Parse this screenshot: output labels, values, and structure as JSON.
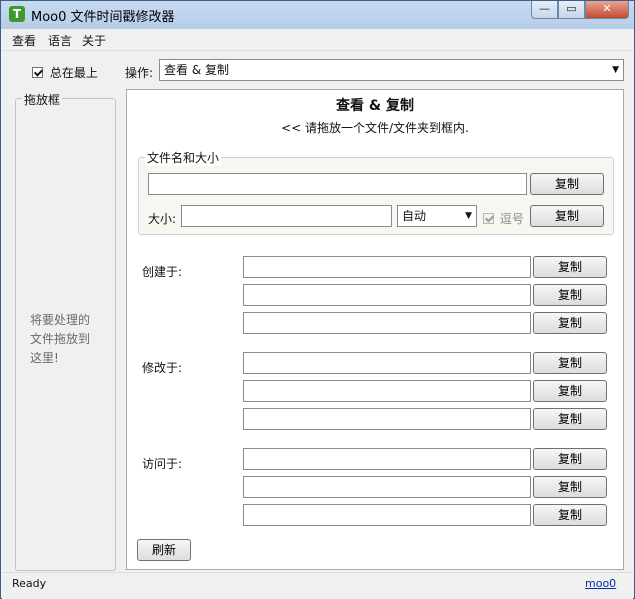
{
  "window": {
    "app_icon_letter": "T",
    "title": "Moo0 文件时间戳修改器",
    "minimize_glyph": "—",
    "maximize_glyph": "▭",
    "close_glyph": "✕"
  },
  "menu": [
    "查看",
    "语言",
    "关于"
  ],
  "topbar": {
    "always_on_top_label": "总在最上",
    "always_on_top_checked": true,
    "operation_label": "操作:",
    "operation_value": "查看 & 复制"
  },
  "drop_zone": {
    "title": "拖放框",
    "instructions": [
      "将要处理的",
      "文件拖放到",
      "这里!"
    ]
  },
  "main": {
    "heading": "查看 & 复制",
    "subheading": "<< 请拖放一个文件/文件夹到框内.",
    "file_group": {
      "legend": "文件名和大小",
      "filename_value": "",
      "size_label": "大小:",
      "size_value": "",
      "unit_value": "自动",
      "comma_label": "逗号",
      "comma_checked": true
    },
    "sections": [
      {
        "label": "创建于:",
        "fields": [
          "",
          "",
          ""
        ]
      },
      {
        "label": "修改于:",
        "fields": [
          "",
          "",
          ""
        ]
      },
      {
        "label": "访问于:",
        "fields": [
          "",
          "",
          ""
        ]
      }
    ],
    "copy_label": "复制",
    "refresh_label": "刷新"
  },
  "status": {
    "text": "Ready",
    "link": "moo0"
  }
}
